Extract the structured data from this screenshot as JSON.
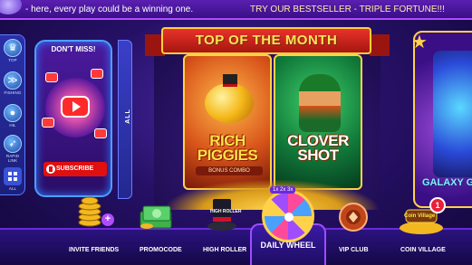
{
  "ticker": {
    "message": "- here, every play could be a winning one.",
    "promo": "TRY OUR BESTSELLER - TRIPLE FORTUNE!!!"
  },
  "rail": {
    "items": [
      {
        "label": "TOP",
        "icon": "crown-icon"
      },
      {
        "label": "FISHING",
        "icon": "fish-icon"
      },
      {
        "label": "HIL",
        "icon": "hil-icon"
      },
      {
        "label": "RAPID LINK",
        "icon": "rocket-icon"
      },
      {
        "label": "ALL",
        "icon": "grid-icon"
      }
    ]
  },
  "dont_miss": {
    "title": "DON'T MISS!",
    "subscribe_label": "SUBSCRIBE"
  },
  "all_tab": {
    "label": "ALL"
  },
  "featured": {
    "title": "TOP OF THE MONTH",
    "games": [
      {
        "name": "RICH PIGGIES",
        "subtitle": "BONUS COMBO"
      },
      {
        "name": "CLOVER SHOT"
      }
    ]
  },
  "right_card": {
    "title": "GALAXY GL"
  },
  "bottom_nav": {
    "invite": "INVITE FRIENDS",
    "promocode": "PROMOCODE",
    "high_roller": "HIGH ROLLER",
    "daily_wheel": "DAILY WHEEL",
    "vip": "VIP CLUB",
    "coin_village": "COIN VILLAGE",
    "coin_village_badge": "1",
    "high_roller_sign": "HIGH ROLLER",
    "coin_village_sign": "Coin Village",
    "wheel_tag": "1x 2x 3x"
  },
  "colors": {
    "background": "#261066",
    "ribbon": "#e8322a",
    "gold": "#ffd24a",
    "subscribe": "#e01010"
  }
}
